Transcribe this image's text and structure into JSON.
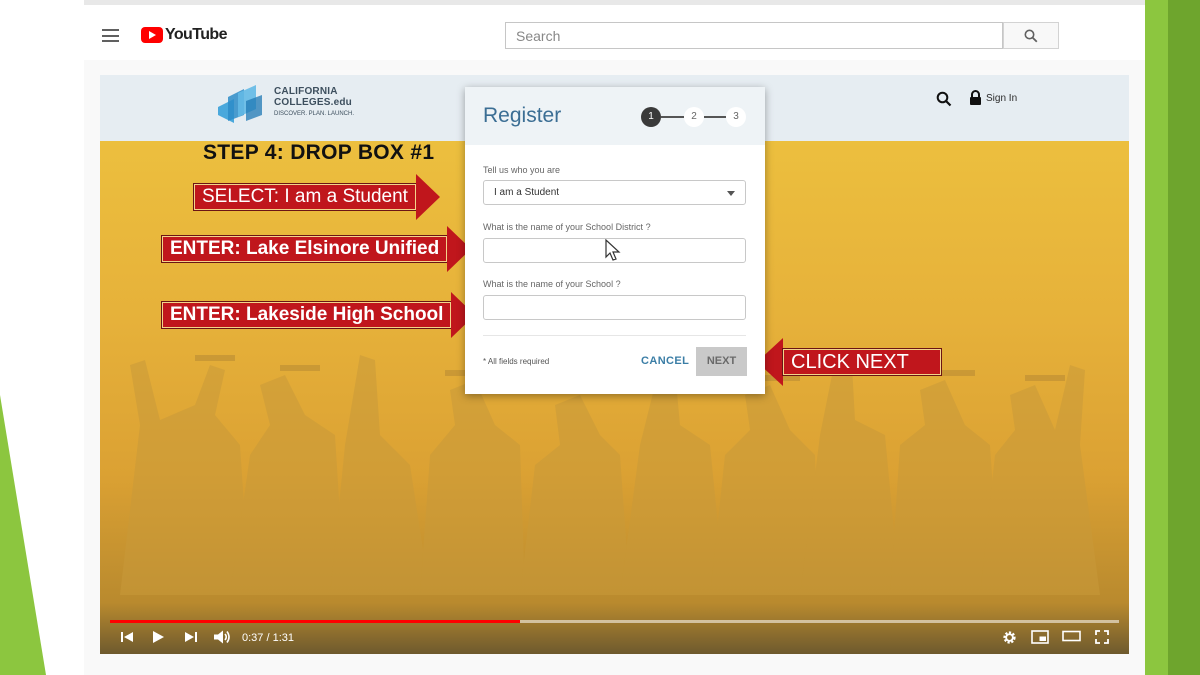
{
  "youtube": {
    "logo_text": "YouTube",
    "search_placeholder": "Search"
  },
  "site": {
    "logo_line1": "CALIFORNIA",
    "logo_line2": "COLLEGES.edu",
    "logo_tagline": "DISCOVER. PLAN. LAUNCH.",
    "sign_in": "Sign In"
  },
  "slide": {
    "step_title": "STEP 4: DROP BOX #1",
    "callouts": [
      "SELECT: I am a Student",
      "ENTER: Lake Elsinore Unified",
      "ENTER: Lakeside High School",
      "CLICK NEXT"
    ]
  },
  "register": {
    "title": "Register",
    "steps": [
      "1",
      "2",
      "3"
    ],
    "active_step": 1,
    "who_label": "Tell us who you are",
    "who_value": "I am a Student",
    "district_label": "What is the name of your School District ?",
    "district_value": "",
    "school_label": "What is the name of your School ?",
    "school_value": "",
    "required_note": "* All fields required",
    "cancel_label": "CANCEL",
    "next_label": "NEXT"
  },
  "player": {
    "time": "0:37 / 1:31",
    "progress_fraction": 0.406
  },
  "colors": {
    "callout_red": "#c0161c",
    "youtube_red": "#ff0000",
    "register_title": "#3b6e94",
    "slide_green": "#8cc63f"
  },
  "icons": [
    "menu-icon",
    "youtube-play-icon",
    "search-icon",
    "lock-icon",
    "skip-back-icon",
    "play-icon",
    "skip-next-icon",
    "volume-icon",
    "settings-icon",
    "miniplayer-icon",
    "theater-icon",
    "fullscreen-icon",
    "mouse-cursor-icon"
  ]
}
